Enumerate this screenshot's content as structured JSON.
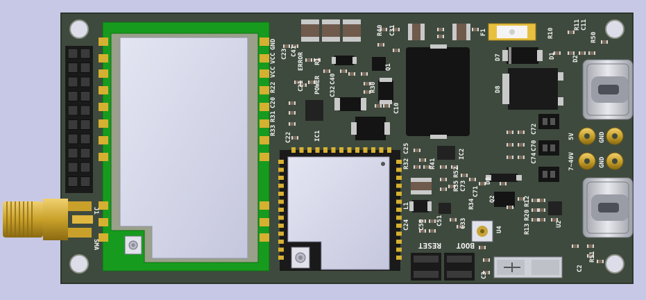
{
  "colors": {
    "background": "#c7c8e6",
    "board": "#3f4a3e",
    "board_edge": "#2d352c",
    "mounting_hole": "#dcdde8",
    "silkscreen": "#f2f2f2",
    "gold": "#c9a12a",
    "module_green": "#179b1e",
    "module_shield": "#d2d4e6",
    "black_part": "#141414"
  },
  "silkscreen": {
    "gnd_top": "GND",
    "vcc_top": "VCC",
    "vcc2": "VCC",
    "r22": "R22",
    "c20": "C20",
    "r31": "R31",
    "r33": "R33",
    "c22": "C22",
    "c23": "C23",
    "c41": "C41",
    "error": "ERROR",
    "r1": "R1",
    "c21": "C21",
    "power": "POWER",
    "c40": "C40",
    "c32": "C32",
    "r30": "R30",
    "ic1": "IC1",
    "r40": "R40",
    "c31": "C31",
    "q1": "Q1",
    "c10": "C10",
    "f1": "F1",
    "r10": "R10",
    "r11": "R11",
    "c11": "C11",
    "r50": "R50",
    "d7": "D7",
    "d1": "D1",
    "d2": "D2",
    "d8": "D8",
    "c72": "C72",
    "c70": "C70",
    "c74": "C74",
    "label_5v": "5V",
    "label_7_40v": "7~40V",
    "gnd_a": "GND",
    "gnd_b": "GND",
    "c25": "C25",
    "r32": "R32",
    "r41": "R41",
    "ic2": "IC2",
    "r35": "R35",
    "r52": "R52",
    "c73": "C73",
    "c71": "C71",
    "d6": "D6",
    "q2": "Q2",
    "r34": "R34",
    "r12": "R12",
    "r20": "R20",
    "r13": "R13",
    "u2": "U2",
    "l1": "L1",
    "c24": "C24",
    "c50": "C50",
    "c51": "C51",
    "c33": "C33",
    "u4": "U4",
    "c3": "C3",
    "reset": "RESET",
    "boot": "BOOT",
    "c2": "C2",
    "r51": "R51",
    "j1": "J1",
    "sma": "SMA"
  }
}
